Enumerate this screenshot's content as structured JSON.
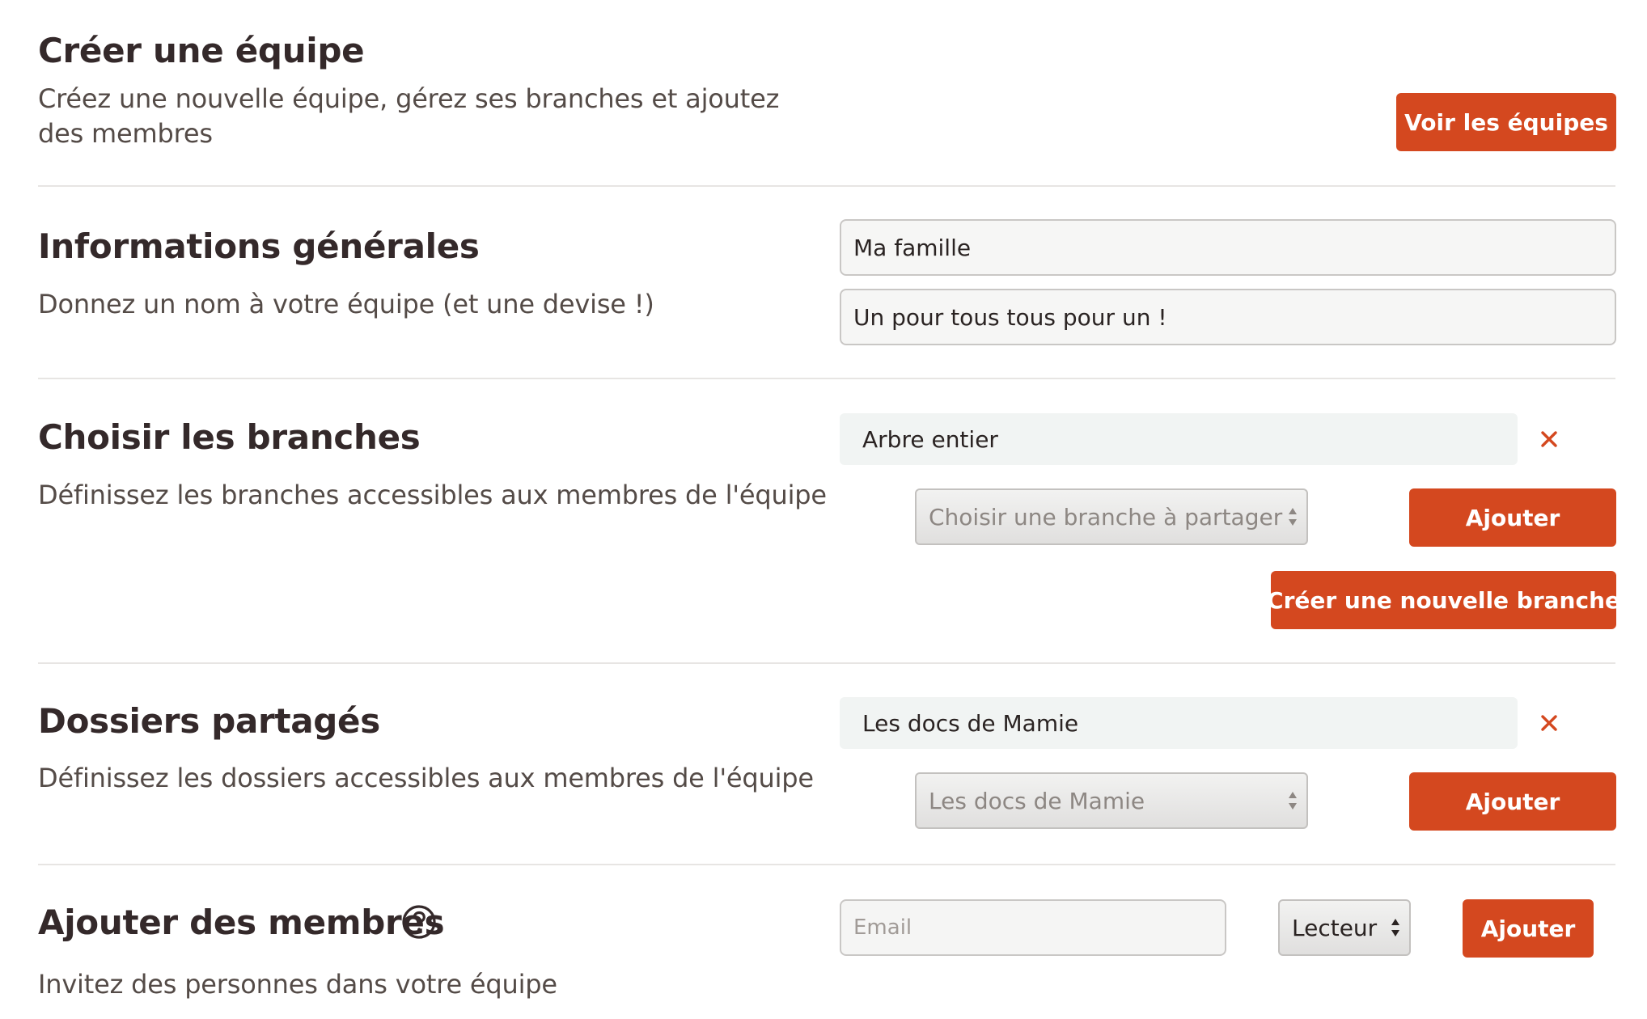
{
  "header": {
    "title": "Créer une équipe",
    "description": "Créez une nouvelle équipe, gérez ses branches et ajoutez des membres",
    "view_teams_button": "Voir les équipes"
  },
  "general": {
    "title": "Informations générales",
    "description": "Donnez un nom à votre équipe (et une devise !)",
    "name_value": "Ma famille",
    "motto_value": "Un pour tous tous pour un !"
  },
  "branches": {
    "title": "Choisir les branches",
    "description": "Définissez les branches accessibles aux membres de l'équipe",
    "items": [
      "Arbre entier"
    ],
    "select_placeholder": "Choisir une branche à partager",
    "add_button": "Ajouter",
    "create_button": "Créer une nouvelle branche"
  },
  "folders": {
    "title": "Dossiers partagés",
    "description": "Définissez les dossiers accessibles aux membres de l'équipe",
    "items": [
      "Les docs de Mamie"
    ],
    "select_value": "Les docs de Mamie",
    "add_button": "Ajouter"
  },
  "members": {
    "title": "Ajouter des membres",
    "description": "Invitez des personnes dans votre équipe",
    "email_placeholder": "Email",
    "role_value": "Lecteur",
    "add_button": "Ajouter"
  },
  "icons": {
    "remove": "close-icon",
    "help": "question-circle-icon",
    "select": "updown-arrows-icon"
  },
  "colors": {
    "accent": "#d4481f",
    "heading": "#34292a",
    "text": "#544b47",
    "divider": "#e7e5e3"
  }
}
